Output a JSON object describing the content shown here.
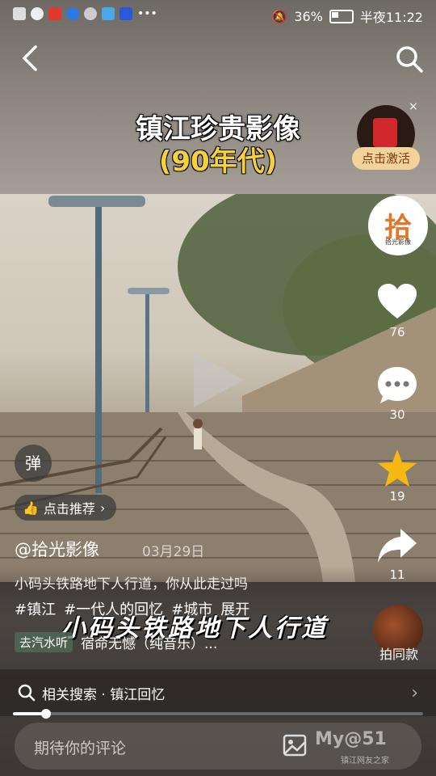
{
  "status_bar": {
    "battery": "36%",
    "time": "半夜11:22"
  },
  "video": {
    "title": "镇江珍贵影像",
    "subtitle": "(90年代)",
    "caption": "小码头铁路地下人行道"
  },
  "promo": {
    "label": "点击激活",
    "close": "×"
  },
  "side": {
    "likes": "76",
    "comments": "30",
    "favorites": "19",
    "shares": "11",
    "avatar_text": "拾",
    "avatar_sub": "拾光影像",
    "same_style": "拍同款"
  },
  "danmaku": {
    "label": "弹"
  },
  "recommend": {
    "label": "点击推荐"
  },
  "info": {
    "author": "@拾光影像",
    "date": "03月29日",
    "description": "小码头铁路地下人行道，你从此走过吗",
    "tags": [
      "#镇江",
      "#一代人的回忆",
      "#城市",
      "展开"
    ],
    "music_chip": "去汽水听",
    "music_title": "宿命无憾（纯音乐）..."
  },
  "related": {
    "label": "相关搜索 · 镇江回忆"
  },
  "progress": {
    "value": 0.08
  },
  "comment": {
    "placeholder": "期待你的评论",
    "watermark": "My@51",
    "watermark_sub": "镇江网友之家"
  }
}
